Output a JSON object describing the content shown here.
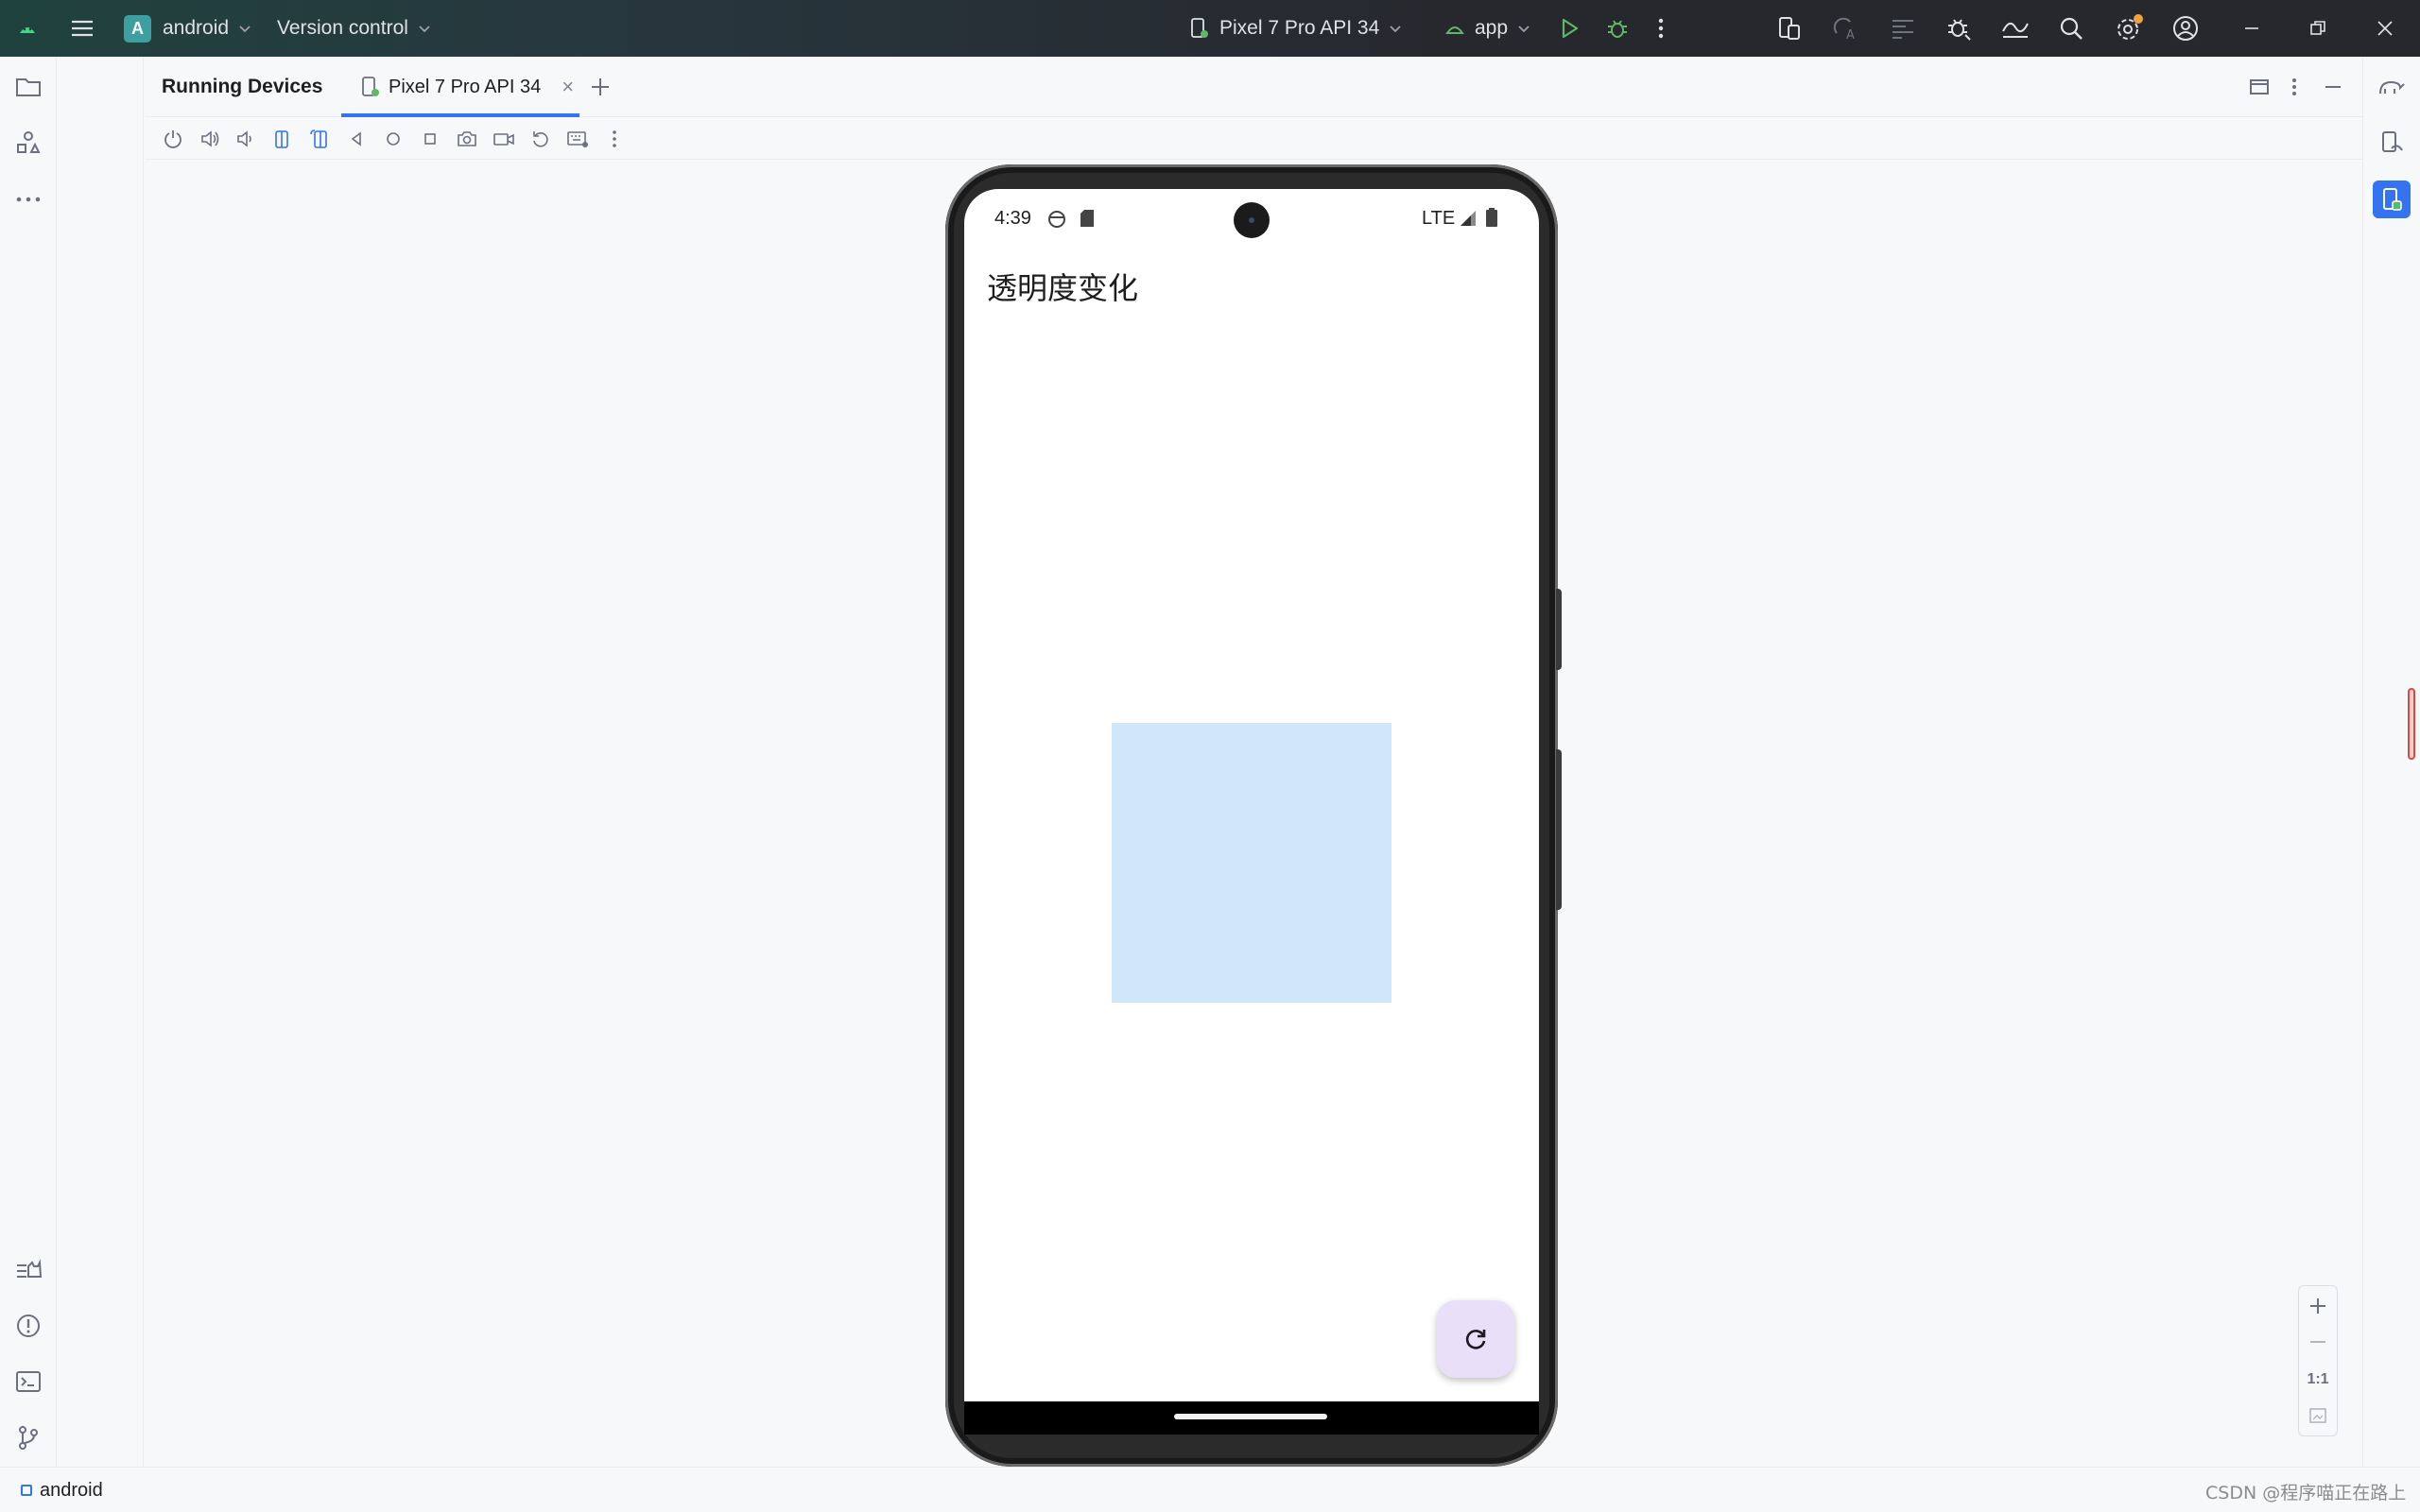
{
  "titlebar": {
    "project_badge": "A",
    "project_name": "android",
    "vcs": "Version control",
    "device_selector": "Pixel 7 Pro API 34",
    "run_config": "app"
  },
  "tool_window": {
    "title": "Running Devices",
    "tab_label": "Pixel 7 Pro API 34"
  },
  "emulator": {
    "status_time": "4:39",
    "network": "LTE",
    "app_title": "透明度变化",
    "box_color": "#d0e6fa",
    "box_alpha_estimate": 0.2,
    "fab_icon": "refresh-icon"
  },
  "zoom": {
    "one_to_one": "1:1"
  },
  "statusbar": {
    "project": "android",
    "watermark": "CSDN @程序喵正在路上"
  },
  "colors": {
    "accent": "#3574f0",
    "run_green": "#5fb865",
    "android_green": "#3ddc84"
  }
}
